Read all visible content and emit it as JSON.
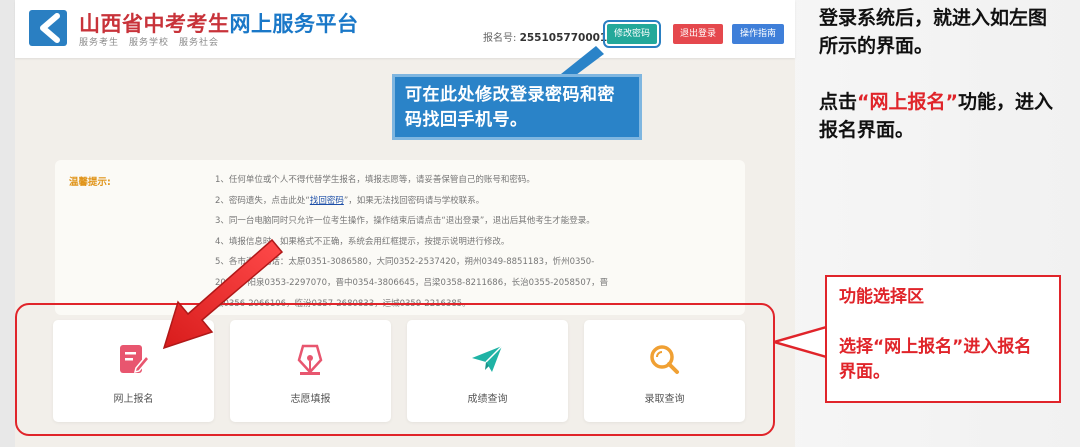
{
  "header": {
    "title_accent": "山西省中考考生",
    "title_rest": "网上服务平台",
    "subtitles": [
      "服务考生",
      "服务学校",
      "服务社会"
    ],
    "reg_label": "报名号:",
    "reg_number": "255105770001",
    "buttons": {
      "change_password": "修改密码",
      "logout": "退出登录",
      "help": "操作指南"
    }
  },
  "notice": {
    "title": "温馨提示:",
    "lines": [
      "1、任何单位或个人不得代替学生报名，填报志愿等，请妥善保管自己的账号和密码。",
      "2、密码遗失，点击此处",
      "3、同一台电脑同时只允许一位考生操作，操作结束后请点击“退出登录”，退出后其他考生才能登录。",
      "4、填报信息时，如果格式不正确，系统会用红框提示，按提示说明进行修改。",
      "5、各市咨询电话：太原0351-3086580，大同0352-2537420，朔州0349-8851183，忻州0350-",
      "2025... 阳泉0353-2297070，晋中0354-3806645，吕梁0358-8211686，长治0355-2058507，晋",
      "城0356-2066106，临汾0357-2680833，运城0359-2216385。"
    ],
    "line2_link": "找回密码",
    "line2_tail": "，如果无法找回密码请与学校联系。"
  },
  "cards": [
    {
      "label": "网上报名",
      "icon": "edit-document-icon",
      "color": "#e8566f"
    },
    {
      "label": "志愿填报",
      "icon": "fountain-pen-icon",
      "color": "#e8566f"
    },
    {
      "label": "成绩查询",
      "icon": "paper-plane-icon",
      "color": "#1fb3a5"
    },
    {
      "label": "录取查询",
      "icon": "magnifier-icon",
      "color": "#f0a033"
    }
  ],
  "annotations": {
    "password_note": "可在此处修改登录密码和密码找回手机号。",
    "select_title": "功能选择区",
    "select_body": "选择“网上报名”进入报名界面。",
    "side_text_1": "登录系统后，就进入如左图所示的界面。",
    "side_text_2_pre": "点击",
    "side_text_2_red": "“网上报名”",
    "side_text_2_post": "功能，进入报名界面。"
  },
  "colors": {
    "brand_blue": "#1a78c8",
    "brand_red": "#c8333a",
    "annotation_red": "#e0242a",
    "annotation_blue": "#2a83c8"
  }
}
